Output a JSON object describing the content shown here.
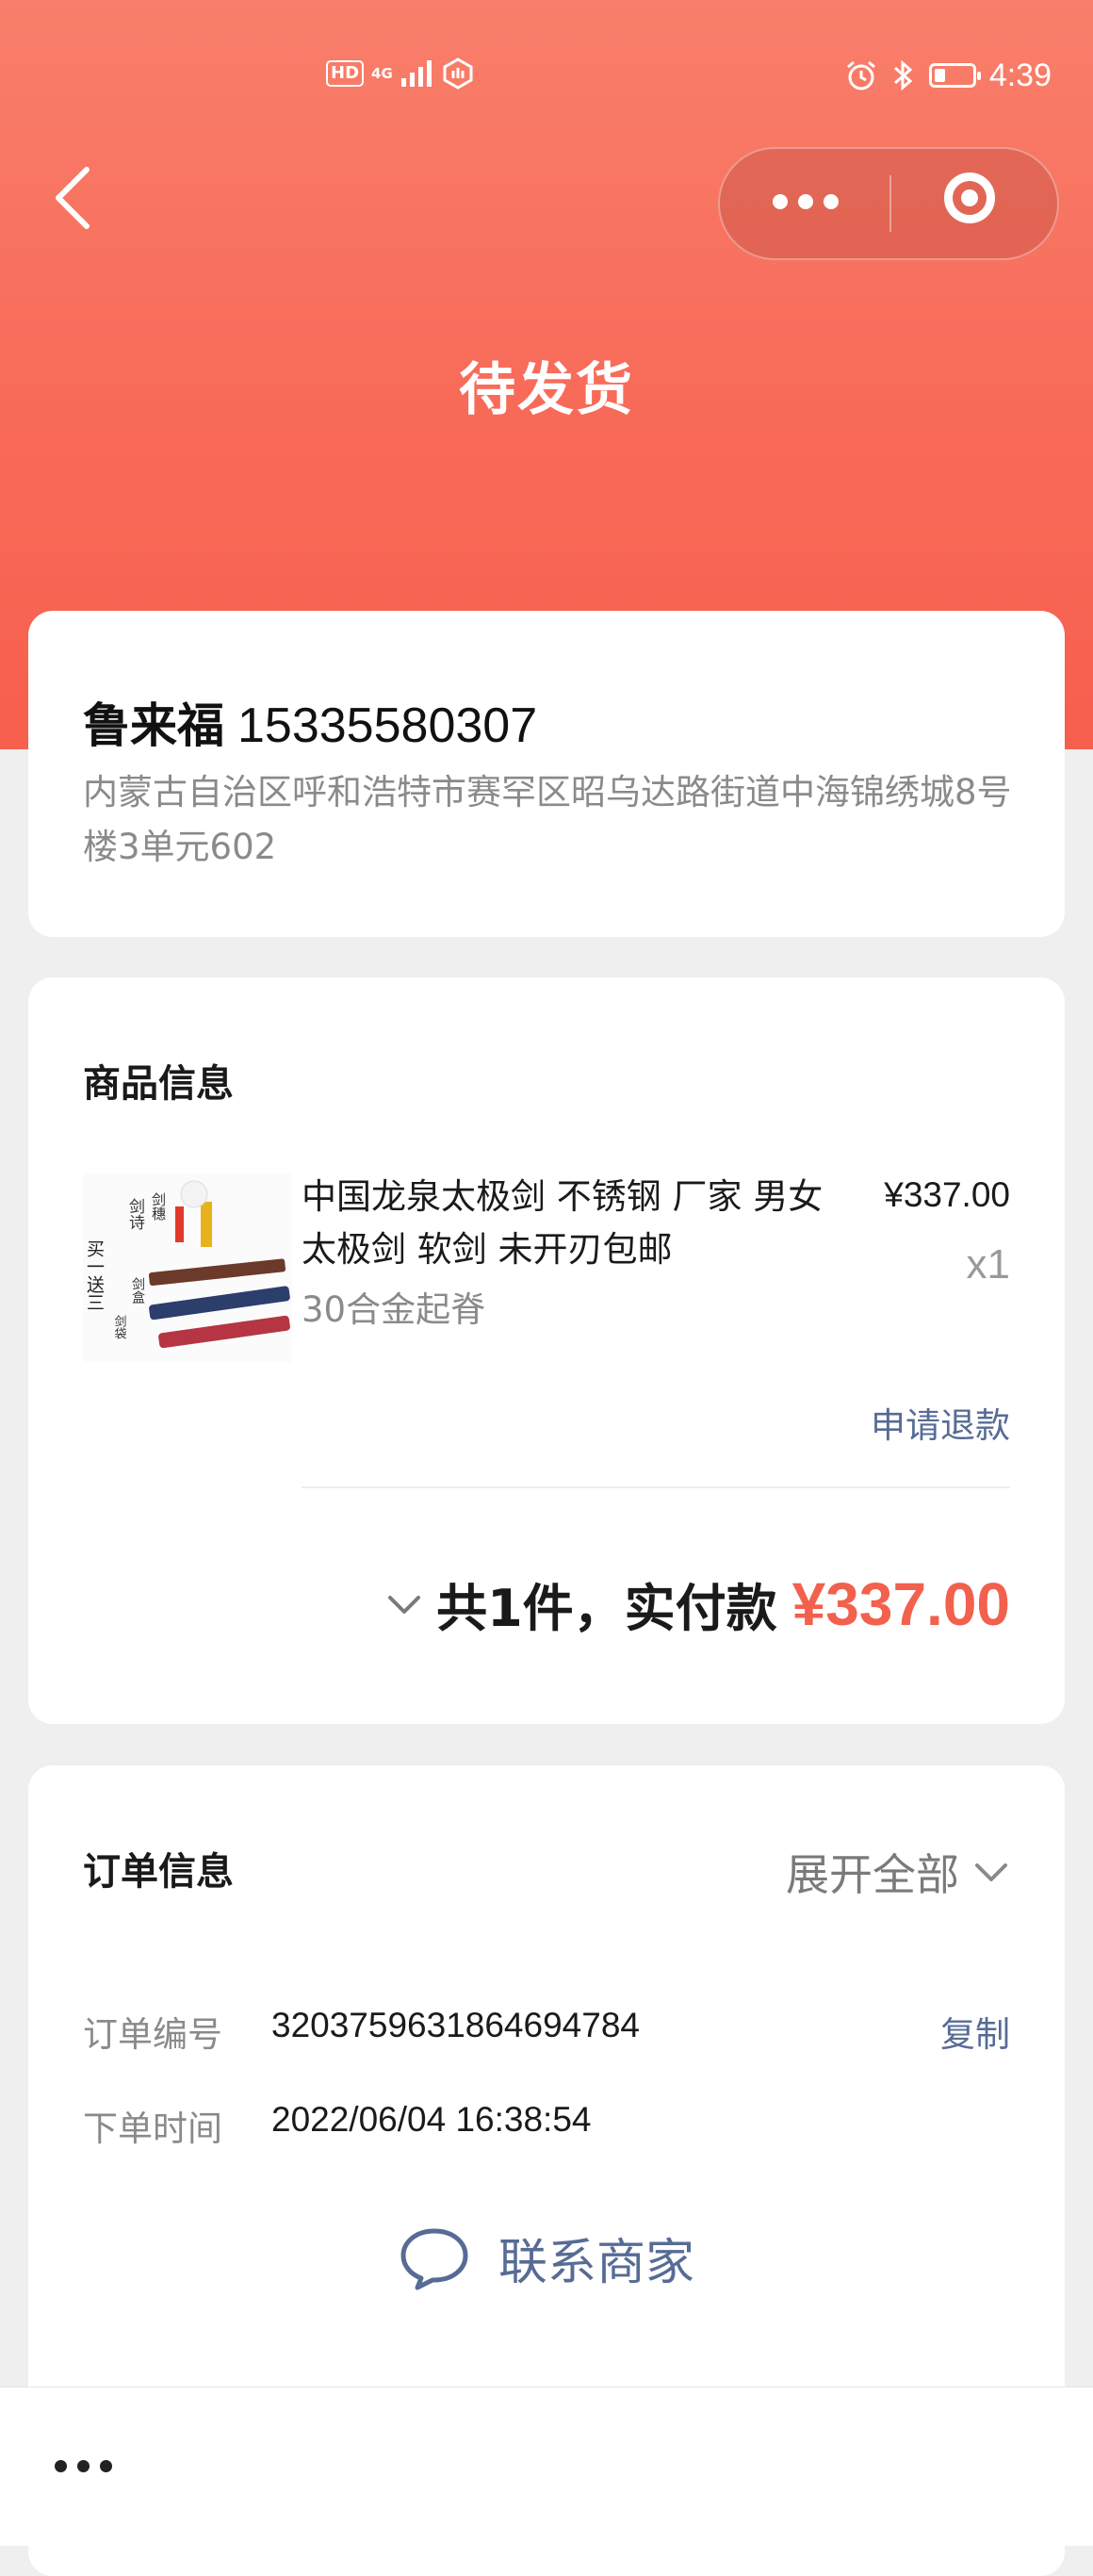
{
  "status_bar": {
    "hd": "HD",
    "network": "4G",
    "time": "4:39",
    "battery_level": 0.3,
    "icons": [
      "hd-icon",
      "signal-icon",
      "hotspot-icon",
      "alarm-icon",
      "bluetooth-icon",
      "battery-icon"
    ]
  },
  "nav": {
    "title": "待发货",
    "back_icon": "chevron-left-icon",
    "more_icon": "more-dots-icon",
    "close_icon": "target-close-icon"
  },
  "address": {
    "name": "鲁来福",
    "phone": "15335580307",
    "detail": "内蒙古自治区呼和浩特市赛罕区昭乌达路街道中海锦绣城8号楼3单元602"
  },
  "goods": {
    "section_title": "商品信息",
    "product": {
      "name": "中国龙泉太极剑 不锈钢 厂家 男女太极剑 软剑 未开刃包邮",
      "spec": "30合金起脊",
      "price": "¥337.00",
      "quantity": "x1",
      "refund_label": "申请退款",
      "image_text": [
        "剑诗",
        "剑穗",
        "买一送三",
        "剑盒",
        "剑袋"
      ]
    },
    "summary": {
      "count_text": "共1件，实付款",
      "total": "¥337.00"
    }
  },
  "order": {
    "section_title": "订单信息",
    "expand_label": "展开全部",
    "order_no_label": "订单编号",
    "order_no": "3203759631864694784",
    "copy_label": "复制",
    "time_label": "下单时间",
    "time": "2022/06/04 16:38:54",
    "contact_label": "联系商家"
  },
  "colors": {
    "header_gradient_top": "#f87f6b",
    "header_gradient_bottom": "#f75f4e",
    "price_accent": "#f2604e",
    "link": "#576b95",
    "background": "#efefef"
  }
}
